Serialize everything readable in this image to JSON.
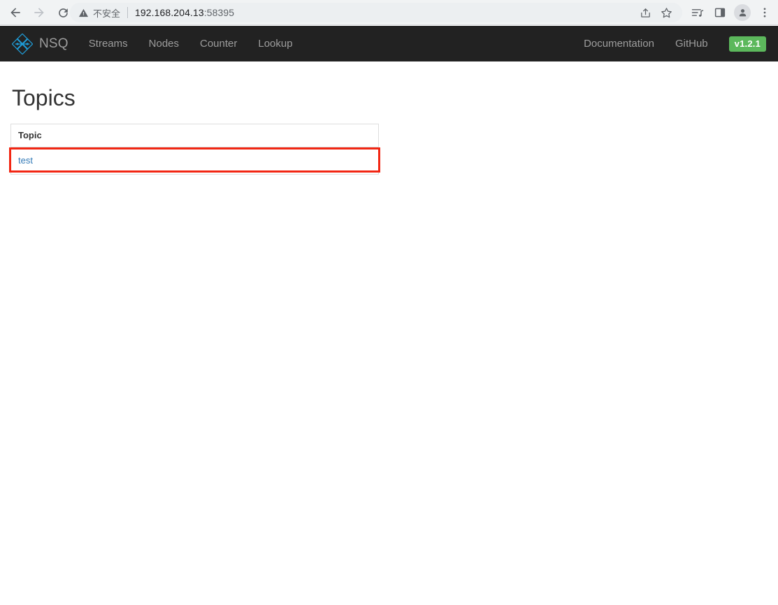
{
  "browser": {
    "back_icon": "back-arrow-icon",
    "forward_icon": "forward-arrow-icon",
    "reload_icon": "reload-icon",
    "security_warning_icon": "warning-triangle-icon",
    "security_label": "不安全",
    "url_host": "192.168.204.13",
    "url_port": ":58395",
    "url_full": "192.168.204.13:58395",
    "omnibox_icons": [
      "share-icon",
      "bookmark-star-icon"
    ],
    "toolbar_icons": [
      "media-playlist-icon",
      "side-panel-icon",
      "profile-avatar-icon",
      "more-menu-icon"
    ]
  },
  "navbar": {
    "brand_logo_icon": "nsq-diamond-logo-icon",
    "brand": "NSQ",
    "links": [
      {
        "label": "Streams"
      },
      {
        "label": "Nodes"
      },
      {
        "label": "Counter"
      },
      {
        "label": "Lookup"
      }
    ],
    "right_links": [
      {
        "label": "Documentation"
      },
      {
        "label": "GitHub"
      }
    ],
    "version": "v1.2.1",
    "colors": {
      "background": "#222222",
      "link": "#9d9d9d",
      "brand_accent": "#1f9bd6",
      "version_badge": "#5cb85c"
    }
  },
  "page": {
    "title": "Topics",
    "table": {
      "columns": [
        "Topic"
      ],
      "rows": [
        {
          "topic": "test"
        }
      ]
    },
    "highlight": {
      "target": "topic-row",
      "color": "#f22613"
    },
    "colors": {
      "link": "#337ab7",
      "text": "#333333",
      "border": "#dddddd"
    }
  }
}
